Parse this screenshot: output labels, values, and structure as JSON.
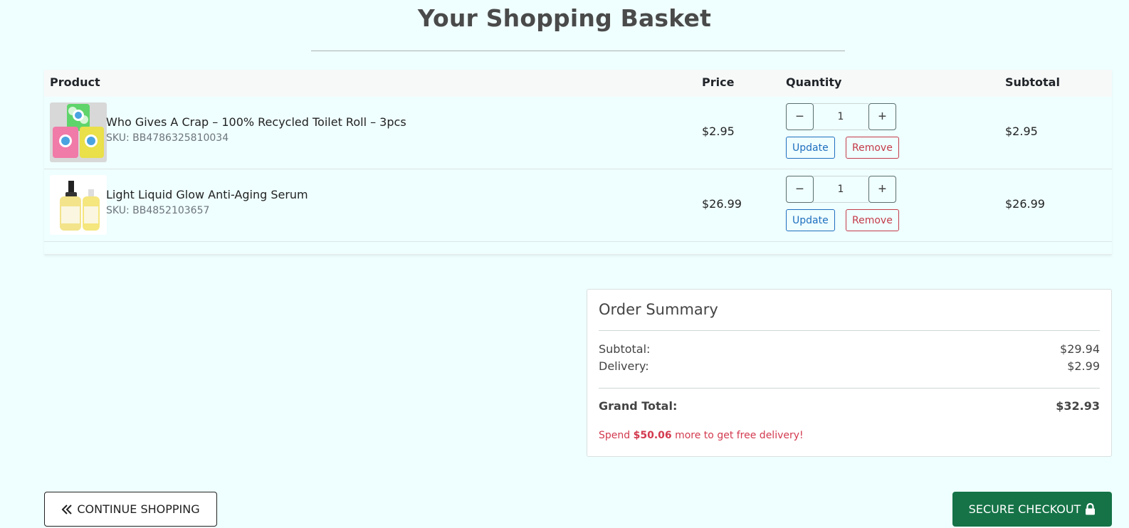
{
  "page": {
    "title": "Your Shopping Basket"
  },
  "table": {
    "headers": {
      "product": "Product",
      "price": "Price",
      "quantity": "Quantity",
      "subtotal": "Subtotal"
    },
    "items": [
      {
        "name": "Who Gives A Crap – 100% Recycled Toilet Roll – 3pcs",
        "sku": "SKU: BB4786325810034",
        "price": "$2.95",
        "quantity": "1",
        "subtotal": "$2.95",
        "update_label": "Update",
        "remove_label": "Remove",
        "image_icon": "toilet-roll-product-image"
      },
      {
        "name": "Light Liquid Glow Anti-Aging Serum",
        "sku": "SKU: BB4852103657",
        "price": "$26.99",
        "quantity": "1",
        "subtotal": "$26.99",
        "update_label": "Update",
        "remove_label": "Remove",
        "image_icon": "serum-bottles-product-image"
      }
    ]
  },
  "summary": {
    "title": "Order Summary",
    "subtotal_label": "Subtotal:",
    "subtotal_value": "$29.94",
    "delivery_label": "Delivery:",
    "delivery_value": "$2.99",
    "grand_total_label": "Grand Total:",
    "grand_total_value": "$32.93",
    "promo_prefix": "Spend",
    "promo_amount": "$50.06",
    "promo_suffix": "more to get free delivery!"
  },
  "footer": {
    "continue_label": "CONTINUE SHOPPING",
    "checkout_label": "SECURE CHECKOUT"
  },
  "colors": {
    "background": "#effefe",
    "checkout_green": "#157347",
    "update_blue": "#1e6fc0",
    "remove_red": "#c43b4a",
    "promo_red": "#d33a4f"
  }
}
